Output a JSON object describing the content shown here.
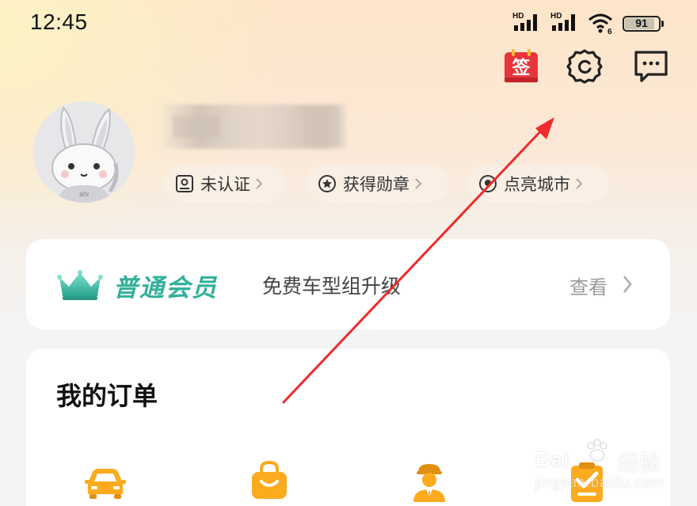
{
  "status_bar": {
    "time": "12:45",
    "signal_1_label": "HD",
    "signal_2_label": "HD",
    "wifi_badge": "6",
    "battery_level": "91",
    "battery_fraction": 0.91
  },
  "header_icons": {
    "sign_in_glyph": "签",
    "sign_in_color": "#e8343a",
    "icons": [
      "sign-in-calendar-icon",
      "settings-gear-icon",
      "message-bubble-icon"
    ]
  },
  "profile": {
    "avatar_text": "ahi",
    "chips": [
      {
        "label": "未认证",
        "icon": "id-card-icon"
      },
      {
        "label": "获得勋章",
        "icon": "medal-icon"
      },
      {
        "label": "点亮城市",
        "icon": "location-pin-icon"
      }
    ]
  },
  "membership": {
    "title": "普通会员",
    "subtitle": "免费车型组升级",
    "view_label": "查看",
    "accent_color": "#33b19b"
  },
  "orders": {
    "title": "我的订单",
    "items": [
      {
        "icon": "car-icon"
      },
      {
        "icon": "shopping-bag-icon"
      },
      {
        "icon": "chauffeur-icon"
      },
      {
        "icon": "clipboard-check-icon"
      }
    ],
    "icon_color": "#fcaa1e"
  },
  "watermark": {
    "brand": "Bai",
    "brand_tail": "经验",
    "url": "jingyan.baidu.com"
  }
}
